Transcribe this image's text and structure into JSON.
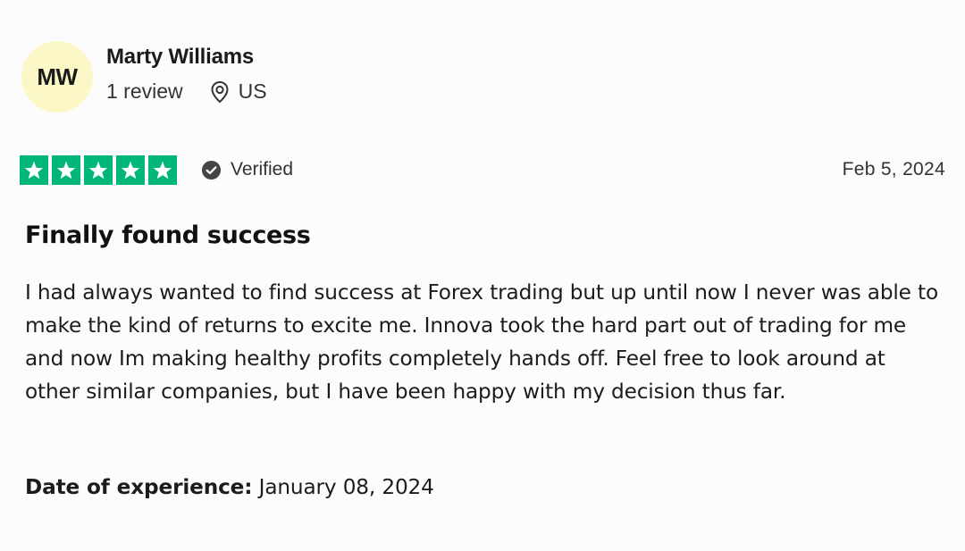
{
  "reviewer": {
    "initials": "MW",
    "name": "Marty Williams",
    "review_count": "1 review",
    "location": "US",
    "avatar_color": "#fbf7c6"
  },
  "rating": {
    "stars": 5,
    "max_stars": 5,
    "star_color": "#00b67a",
    "verified_label": "Verified",
    "date": "Feb 5, 2024"
  },
  "review": {
    "title": "Finally found success",
    "body": "I had always wanted to find success at Forex trading but up until now I never was able to make the kind of returns to excite me. Innova took the hard part out of trading for me and now Im making healthy profits completely hands off. Feel free to look around at other similar companies, but I have been happy with my decision thus far.",
    "experience_label": "Date of experience:",
    "experience_date": "January 08, 2024"
  },
  "icons": {
    "location": "map-pin-icon",
    "verified": "check-circle-icon",
    "star": "star-icon"
  }
}
